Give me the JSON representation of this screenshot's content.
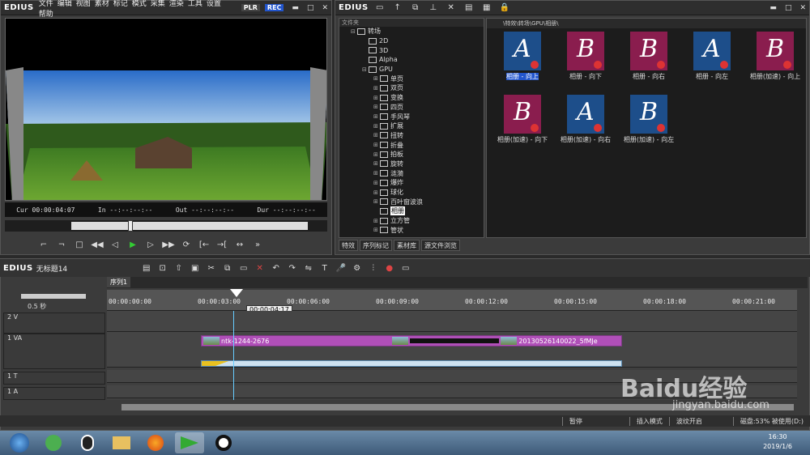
{
  "player": {
    "logo": "EDIUS",
    "menu": [
      "文件",
      "编辑",
      "视图",
      "素材",
      "标记",
      "模式",
      "采集",
      "渲染",
      "工具",
      "设置",
      "帮助"
    ],
    "plr": "PLR",
    "rec": "REC",
    "cur_label": "Cur",
    "cur": "00:00:04:07",
    "in_label": "In",
    "in": "--:--:--:--",
    "out_label": "Out",
    "out": "--:--:--:--",
    "dur_label": "Dur",
    "dur": "--:--:--:--"
  },
  "bin": {
    "logo": "EDIUS",
    "tree_header": "文件夹",
    "tree": [
      {
        "label": "转场",
        "indent": 1,
        "pm": "⊟"
      },
      {
        "label": "2D",
        "indent": 2,
        "pm": ""
      },
      {
        "label": "3D",
        "indent": 2,
        "pm": ""
      },
      {
        "label": "Alpha",
        "indent": 2,
        "pm": ""
      },
      {
        "label": "GPU",
        "indent": 2,
        "pm": "⊟"
      },
      {
        "label": "单页",
        "indent": 3,
        "pm": "⊞"
      },
      {
        "label": "双页",
        "indent": 3,
        "pm": "⊞"
      },
      {
        "label": "变换",
        "indent": 3,
        "pm": "⊞"
      },
      {
        "label": "四页",
        "indent": 3,
        "pm": "⊞"
      },
      {
        "label": "手风琴",
        "indent": 3,
        "pm": "⊞"
      },
      {
        "label": "扩展",
        "indent": 3,
        "pm": "⊞"
      },
      {
        "label": "扭转",
        "indent": 3,
        "pm": "⊞"
      },
      {
        "label": "折叠",
        "indent": 3,
        "pm": "⊞"
      },
      {
        "label": "拍板",
        "indent": 3,
        "pm": "⊞"
      },
      {
        "label": "旋转",
        "indent": 3,
        "pm": "⊞"
      },
      {
        "label": "涟漪",
        "indent": 3,
        "pm": "⊞"
      },
      {
        "label": "爆炸",
        "indent": 3,
        "pm": "⊞"
      },
      {
        "label": "球化",
        "indent": 3,
        "pm": "⊞"
      },
      {
        "label": "百叶窗波浪",
        "indent": 3,
        "pm": "⊞"
      },
      {
        "label": "相册",
        "indent": 3,
        "pm": "",
        "selected": true
      },
      {
        "label": "立方管",
        "indent": 3,
        "pm": "⊞"
      },
      {
        "label": "管状",
        "indent": 3,
        "pm": "⊞"
      }
    ],
    "tabs": [
      "特效",
      "序列标记",
      "素材库",
      "源文件浏览"
    ],
    "path": "\\特效\\转场\\GPU\\相册\\",
    "thumbs": [
      {
        "label": "相册 - 向上",
        "letter": "A",
        "bg": "#1d4e8a",
        "selected": true
      },
      {
        "label": "相册 - 向下",
        "letter": "B",
        "bg": "#8a1d4e"
      },
      {
        "label": "相册 - 向右",
        "letter": "B",
        "bg": "#8a1d4e"
      },
      {
        "label": "相册 - 向左",
        "letter": "A",
        "bg": "#1d4e8a"
      },
      {
        "label": "相册(加速) - 向上",
        "letter": "B",
        "bg": "#8a1d4e"
      },
      {
        "label": "相册(加速) - 向下",
        "letter": "B",
        "bg": "#8a1d4e"
      },
      {
        "label": "相册(加速) - 向右",
        "letter": "A",
        "bg": "#1d4e8a"
      },
      {
        "label": "相册(加速) - 向左",
        "letter": "B",
        "bg": "#1d4e8a"
      }
    ]
  },
  "timeline": {
    "logo": "EDIUS",
    "project": "无标题14",
    "sequence": "序列1",
    "zoom": "0.5 秒",
    "playhead_tip": "00:00:04:17",
    "ruler": [
      "00:00:00:00",
      "00:00:03:00",
      "00:00:06:00",
      "00:00:09:00",
      "00:00:12:00",
      "00:00:15:00",
      "00:00:18:00",
      "00:00:21:00"
    ],
    "tracks": [
      "2 V",
      "1 VA",
      "1 T",
      "1 A"
    ],
    "clip1": "ntk-1244-2676",
    "clip2": "20130526140022_5fMJe"
  },
  "status": [
    "暂停",
    "插入模式",
    "波纹开启",
    "磁盘:53% 被使用(D:)"
  ],
  "clock": {
    "time": "16:30",
    "date": "2019/1/6"
  },
  "watermark": {
    "brand": "Baidu经验",
    "url": "jingyan.baidu.com"
  }
}
